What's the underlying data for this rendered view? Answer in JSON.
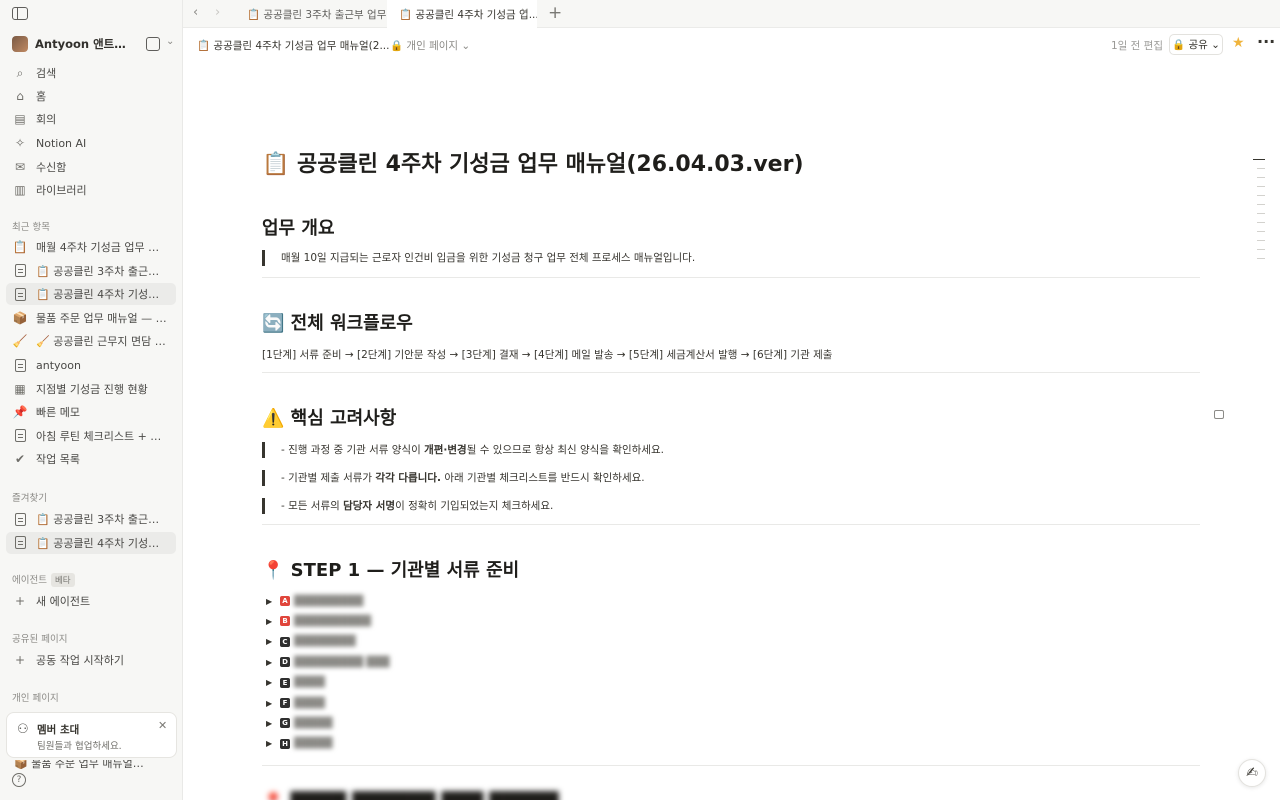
{
  "sidebar": {
    "workspace_name": "Antyoon 앤트윤의 ...",
    "nav": [
      {
        "icon": "search-icon",
        "glyph": "⌕",
        "label": "검색"
      },
      {
        "icon": "home-icon",
        "glyph": "⌂",
        "label": "홈"
      },
      {
        "icon": "meeting-icon",
        "glyph": "▤",
        "label": "회의"
      },
      {
        "icon": "notion-ai-icon",
        "glyph": "✧",
        "label": "Notion AI"
      },
      {
        "icon": "inbox-icon",
        "glyph": "✉",
        "label": "수신함"
      },
      {
        "icon": "library-icon",
        "glyph": "▥",
        "label": "라이브러리"
      }
    ],
    "recent_label": "최근 항목",
    "recent": [
      {
        "emoji": "📋",
        "label": "매월 4주차 기성금 업무 워크..."
      },
      {
        "emoji": "doc",
        "label": "📋 공공클린 3주차 출근부 업..."
      },
      {
        "emoji": "doc",
        "label": "📋 공공클린 4주차 기성금 업..."
      },
      {
        "emoji": "📦",
        "label": "물품 주문 업무 매뉴얼 — 워크..."
      },
      {
        "emoji": "🧹",
        "label": "🧹 공공클린 근무지 면담 업무 ..."
      },
      {
        "emoji": "doc",
        "label": "antyoon"
      },
      {
        "emoji": "table",
        "label": "지점별 기성금 진행 현황"
      },
      {
        "emoji": "📌",
        "label": "빠른 메모"
      },
      {
        "emoji": "doc",
        "label": "아침 루틴 체크리스트 + 감정..."
      },
      {
        "emoji": "✔",
        "label": "작업 목록"
      }
    ],
    "favorites_label": "즐겨찾기",
    "favorites": [
      {
        "label": "📋 공공클린 3주차 출근부 업..."
      },
      {
        "label": "📋 공공클린 4주차 기성금 업..."
      }
    ],
    "agents_label": "에이전트",
    "beta_label": "베타",
    "new_agent": "새 에이전트",
    "shared_label": "공유된 페이지",
    "start_collab": "공동 작업 시작하기",
    "private_label": "개인 페이지",
    "invite_title": "멤버 초대",
    "invite_sub": "팀원들과 협업하세요.",
    "bottom_peek": "📦 물품 주문 업무 매뉴얼 — 워크..."
  },
  "tabs": [
    {
      "label": "📋 공공클린 3주차 출근부 업무 매",
      "active": false
    },
    {
      "label": "📋 공공클린 4주차 기성금 업...",
      "active": true
    }
  ],
  "topbar": {
    "breadcrumb": "📋 공공클린 4주차 기성금 업무 매뉴얼(2...",
    "privacy": "🔒 개인 페이지 ⌄",
    "edited": "1일 전 편집",
    "share": "🔒 공유 ⌄"
  },
  "page": {
    "title": "📋 공공클린 4주차 기성금 업무 매뉴얼(26.04.03.ver)",
    "overview_heading": "업무 개요",
    "overview_quote": "매월 10일 지급되는 근로자 인건비 입금을 위한 기성금 청구 업무 전체 프로세스 매뉴얼입니다.",
    "workflow_heading": "🔄 전체 워크플로우",
    "workflow_text": "[1단계] 서류 준비  →  [2단계] 기안문 작성  →  [3단계] 결재  →  [4단계] 메일 발송  →  [5단계] 세금계산서 발행  →  [6단계] 기관 제출",
    "considerations_heading": "⚠️ 핵심 고려사항",
    "considerations": [
      {
        "pre": "- 진행 과정 중 기관 서류 양식이 ",
        "bold": "개편·변경",
        "post": "될 수 있으므로 항상 최신 양식을 확인하세요."
      },
      {
        "pre": "- 기관별 제출 서류가 ",
        "bold": "각각 다릅니다.",
        "post": " 아래 기관별 체크리스트를 반드시 확인하세요."
      },
      {
        "pre": "- 모든 서류의 ",
        "bold": "담당자 서명",
        "post": "이 정확히 기입되었는지 체크하세요."
      }
    ],
    "step1_heading": "📍 STEP 1 — 기관별 서류 준비",
    "step1_items": [
      {
        "badge": "A",
        "color": "#e0453b",
        "label": "█████████"
      },
      {
        "badge": "B",
        "color": "#e0453b",
        "label": "██████████"
      },
      {
        "badge": "C",
        "color": "#2f2f2f",
        "label": "████████"
      },
      {
        "badge": "D",
        "color": "#2f2f2f",
        "label": "█████████ ███"
      },
      {
        "badge": "E",
        "color": "#2f2f2f",
        "label": "████"
      },
      {
        "badge": "F",
        "color": "#2f2f2f",
        "label": "████"
      },
      {
        "badge": "G",
        "color": "#2f2f2f",
        "label": "█████"
      },
      {
        "badge": "H",
        "color": "#2f2f2f",
        "label": "█████"
      }
    ],
    "next_heading": "📍 ████ ██████ ███ █████"
  }
}
